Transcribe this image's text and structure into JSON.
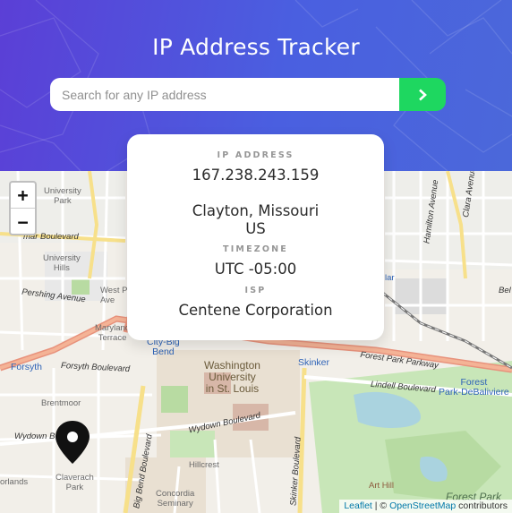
{
  "header": {
    "title": "IP Address Tracker"
  },
  "search": {
    "placeholder": "Search for any IP address",
    "value": "",
    "submit_icon": "chevron-right-icon"
  },
  "info": {
    "ip_label": "IP ADDRESS",
    "ip_value": "167.238.243.159",
    "city_line": "Clayton, Missouri",
    "country_line": "US",
    "timezone_label": "TIMEZONE",
    "timezone_value": "UTC -05:00",
    "isp_label": "ISP",
    "isp_value": "Centene Corporation"
  },
  "map": {
    "zoom_in": "+",
    "zoom_out": "−",
    "marker_icon": "location-pin-icon",
    "labels": {
      "university_park": "University\nPark",
      "university_hills": "University\nHills",
      "delmar": "mar Boulevard",
      "pershing": "Pershing Avenue",
      "west_pa": "West P\nAve",
      "maryland_terrace": "Maryland\nTerrace",
      "forsyth": "Forsyth",
      "forsyth_blvd": "Forsyth Boulevard",
      "city_big_bend": "City-Big\nBend",
      "washington_university": "Washington\nUniversity\nin St. Louis",
      "skinker": "Skinker",
      "forest_park_parkway": "Forest Park Parkway",
      "lindell": "Lindell Boulevard",
      "forest_park_debaliviere": "Forest\nPark-DeBaliviere",
      "brentmoor": "Brentmoor",
      "wydown_left": "Wydown B",
      "wydown_right": "Wydown Boulevard",
      "claverach": "Claverach\nPark",
      "orlands": "orlands",
      "big_bend_blvd": "Big Bend Boulevard",
      "hillcrest": "Hillcrest",
      "concordia": "Concordia\nSeminary",
      "skinker_blvd": "Skinker Boulevard",
      "art_hill": "Art Hill",
      "forest_park": "Forest Park",
      "hamilton": "Hamilton Avenue",
      "clara": "Clara Avenue",
      "lar": "lar",
      "bel": "Bel"
    },
    "attribution": {
      "leaflet": "Leaflet",
      "sep": " | © ",
      "osm": "OpenStreetMap",
      "suffix": " contributors"
    }
  },
  "colors": {
    "accent": "#1ed760",
    "header": "#4b5ee0",
    "card_text": "#2b2b2b"
  }
}
